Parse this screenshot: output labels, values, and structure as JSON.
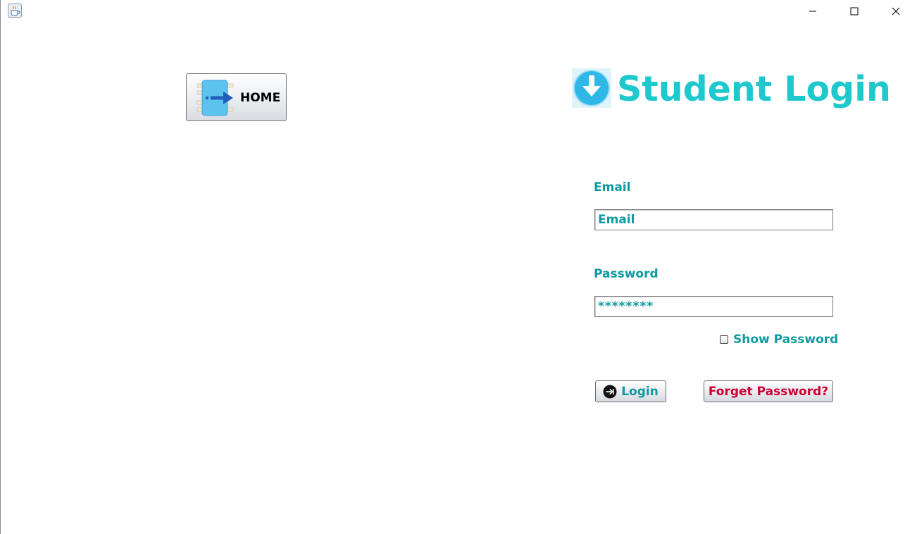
{
  "window": {
    "app_icon": "java-cup-icon",
    "controls": {
      "minimize": "minimize-icon",
      "maximize": "maximize-icon",
      "close": "close-icon"
    }
  },
  "home": {
    "label": "HOME",
    "icon": "exit-door-arrow-icon"
  },
  "header": {
    "title": "Student Login",
    "logo_icon": "download-arrow-circle-icon"
  },
  "form": {
    "email_label": "Email",
    "email_value": "Email",
    "password_label": "Password",
    "password_value": "********",
    "show_password_label": "Show Password",
    "show_password_checked": false,
    "login_label": "Login",
    "login_icon": "login-arrow-icon",
    "forget_label": "Forget Password?"
  },
  "colors": {
    "title": "#1ec8cd",
    "label_text": "#0e9aa0",
    "forget_text": "#cc0033"
  }
}
